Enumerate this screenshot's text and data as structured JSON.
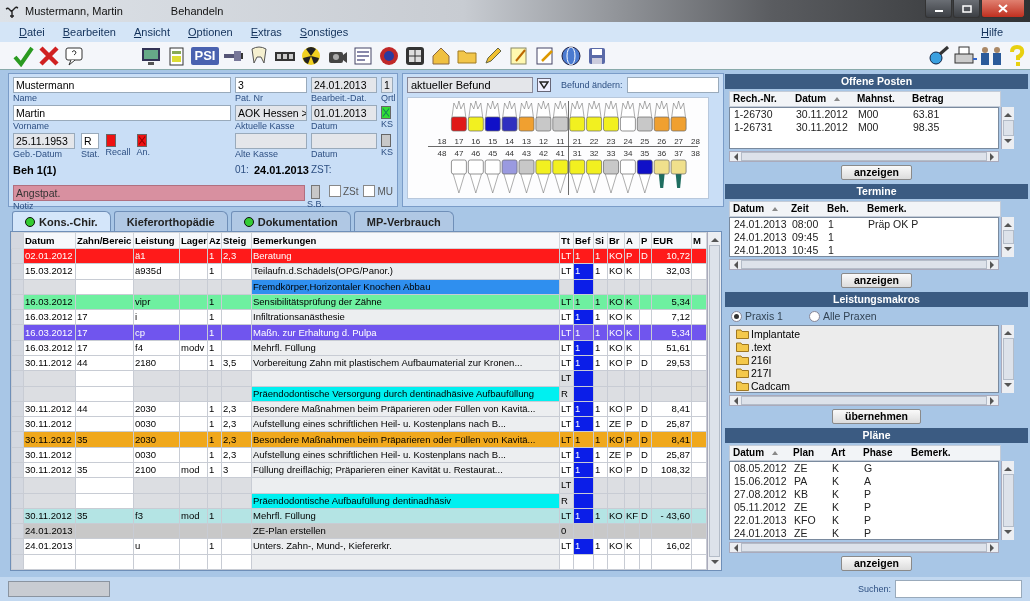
{
  "window": {
    "title": "Mustermann, Martin",
    "subtitle": "Behandeln"
  },
  "menu": [
    {
      "label": "Datei"
    },
    {
      "label": "Bearbeiten"
    },
    {
      "label": "Ansicht"
    },
    {
      "label": "Optionen"
    },
    {
      "label": "Extras"
    },
    {
      "label": "Sonstiges"
    }
  ],
  "help_menu": "Hilfe",
  "toolbar": {
    "psi_label": "PSI"
  },
  "patient": {
    "name": "Mustermann",
    "name_label": "Name",
    "first_name": "Martin",
    "first_name_label": "Vorname",
    "birth_date": "25.11.1953",
    "birth_date_label": "Geb.-Datum",
    "status": "R",
    "status_label": "Stat.",
    "flags": [
      {
        "label": "Recall",
        "color": "#ee1111",
        "crossed": false
      },
      {
        "label": "An.",
        "color": "#ee1111",
        "crossed": true
      }
    ],
    "treatment": "Beh 1(1)",
    "patient_no": "3",
    "patient_no_label": "Pat. Nr",
    "insurance": "AOK Hessen >",
    "insurance_label": "Aktuelle Kasse",
    "old_insurance_label": "Alte Kasse",
    "zst_prefix": "01:",
    "zst_date": "24.01.2013",
    "zst_label": "ZST:",
    "edit_date": "24.01.2013",
    "edit_date_label": "Bearbeit.-Dat.",
    "quarter": "1",
    "quarter_label": "Qrtl",
    "date": "01.01.2013",
    "date_label": "Datum",
    "old_date_label": "Datum",
    "ks": [
      {
        "label": "KS",
        "color": "#33dd33",
        "crossed": true
      },
      {
        "label": "KS",
        "color": "#c8c8c8",
        "crossed": false
      }
    ],
    "note": "Angstpat.",
    "note_label": "Notiz",
    "sb_label": "S.B.",
    "checks": [
      {
        "label": "ZSt",
        "checked": false
      },
      {
        "label": "MU",
        "checked": false
      }
    ]
  },
  "findings": {
    "view": "aktueller Befund",
    "change_label": "Befund ändern:",
    "upper": [
      {
        "number": "18",
        "kind": "gap"
      },
      {
        "number": "17",
        "kind": "tooth",
        "color": "#e01818"
      },
      {
        "number": "16",
        "kind": "tooth",
        "color": "#f2f020"
      },
      {
        "number": "15",
        "kind": "tooth",
        "color": "#1010c8"
      },
      {
        "number": "14",
        "kind": "tooth",
        "color": "#3030c0"
      },
      {
        "number": "13",
        "kind": "tooth",
        "color": "#f0a030"
      },
      {
        "number": "12",
        "kind": "tooth",
        "color": "#c8c8c8"
      },
      {
        "number": "11",
        "kind": "tooth",
        "color": "#c8c8c8"
      },
      {
        "number": "21",
        "kind": "tooth",
        "color": "#f2f020"
      },
      {
        "number": "22",
        "kind": "tooth",
        "color": "#f2f020"
      },
      {
        "number": "23",
        "kind": "tooth",
        "color": "#f2f020"
      },
      {
        "number": "24",
        "kind": "tooth",
        "color": "#ffffff"
      },
      {
        "number": "25",
        "kind": "tooth",
        "color": "#c8c8c8"
      },
      {
        "number": "26",
        "kind": "tooth",
        "color": "#f0a030"
      },
      {
        "number": "27",
        "kind": "tooth",
        "color": "#f0a030"
      },
      {
        "number": "28",
        "kind": "gap"
      }
    ],
    "lower": [
      {
        "number": "48",
        "kind": "gap"
      },
      {
        "number": "47",
        "kind": "tooth",
        "color": "#ffffff"
      },
      {
        "number": "46",
        "kind": "tooth",
        "color": "#ffffff"
      },
      {
        "number": "45",
        "kind": "tooth",
        "color": "#ffffff"
      },
      {
        "number": "44",
        "kind": "tooth",
        "color": "#9a9ae0"
      },
      {
        "number": "43",
        "kind": "tooth",
        "color": "#c8c8c8"
      },
      {
        "number": "42",
        "kind": "tooth",
        "color": "#f2f020"
      },
      {
        "number": "41",
        "kind": "tooth",
        "color": "#f2f020"
      },
      {
        "number": "31",
        "kind": "tooth",
        "color": "#f2f020"
      },
      {
        "number": "32",
        "kind": "tooth",
        "color": "#f2f020"
      },
      {
        "number": "33",
        "kind": "tooth",
        "color": "#c8c8c8"
      },
      {
        "number": "34",
        "kind": "tooth",
        "color": "#ffffff"
      },
      {
        "number": "35",
        "kind": "tooth",
        "color": "#1010c8"
      },
      {
        "number": "36",
        "kind": "implant",
        "color": "#f0e08c"
      },
      {
        "number": "37",
        "kind": "implant",
        "color": "#f0e08c"
      },
      {
        "number": "38",
        "kind": "gap"
      }
    ]
  },
  "tabs": [
    {
      "label": "Kons.-Chir.",
      "selected": true,
      "dot": true
    },
    {
      "label": "Kieferorthopädie",
      "selected": false,
      "dot": false
    },
    {
      "label": "Dokumentation",
      "selected": false,
      "dot": true
    },
    {
      "label": "MP-Verbrauch",
      "selected": false,
      "dot": false
    }
  ],
  "treatment_table": {
    "columns": [
      "Datum",
      "Zahn/Bereic",
      "Leistung",
      "Lager",
      "Az",
      "Steig",
      "Bemerkungen",
      "Tt",
      "Bef",
      "Si",
      "Br",
      "A",
      "P",
      "EUR",
      "M"
    ],
    "rows": [
      {
        "datum": "02.01.2012",
        "leistung": "ä1",
        "az": "1",
        "steig": "2,3",
        "bemerkung": "Beratung",
        "tt": "LT",
        "bef": "1",
        "si": "1",
        "br": "KO",
        "a": "P",
        "p": "D",
        "eur": "10,72",
        "color": "#ff1a1a",
        "bef_marked": false
      },
      {
        "datum": "15.03.2012",
        "leistung": "ä935d",
        "az": "1",
        "bemerkung": "Teilaufn.d.Schädels(OPG/Panor.)",
        "tt": "LT",
        "bef": "1",
        "si": "1",
        "br": "KO",
        "a": "K",
        "eur": "32,03",
        "bef_marked": true
      },
      {
        "bemerkung": "Fremdkörper,Horizontaler Knochen Abbau",
        "highlight": {
          "color": "#2f8fef"
        },
        "bef_marked": true
      },
      {
        "datum": "16.03.2012",
        "leistung": "vipr",
        "az": "1",
        "bemerkung": "Sensibilitätsprüfung der Zähne",
        "tt": "LT",
        "bef": "1",
        "si": "1",
        "br": "KO",
        "a": "K",
        "eur": "5,34",
        "color": "#6ef0a0",
        "bef_marked": false
      },
      {
        "datum": "16.03.2012",
        "zahn": "17",
        "leistung": "i",
        "az": "1",
        "bemerkung": "Infiltrationsanästhesie",
        "tt": "LT",
        "bef": "1",
        "si": "1",
        "br": "KO",
        "a": "K",
        "eur": "7,12",
        "bef_marked": true
      },
      {
        "datum": "16.03.2012",
        "zahn": "17",
        "leistung": "cp",
        "az": "1",
        "bemerkung": "Maßn. zur Erhaltung d. Pulpa",
        "tt": "LT",
        "bef": "1",
        "si": "1",
        "br": "KO",
        "a": "K",
        "eur": "5,34",
        "color": "#7055ee",
        "bef_marked": false
      },
      {
        "datum": "16.03.2012",
        "zahn": "17",
        "leistung": "f4",
        "lager": "modv",
        "az": "1",
        "bemerkung": "Mehrfl. Füllung",
        "tt": "LT",
        "bef": "1",
        "si": "1",
        "br": "KO",
        "a": "K",
        "eur": "51,61",
        "bef_marked": true
      },
      {
        "datum": "30.11.2012",
        "zahn": "44",
        "leistung": "2180",
        "az": "1",
        "steig": "3,5",
        "bemerkung": "Vorbereitung Zahn mit plastischem Aufbaumaterial zur Kronen...",
        "tt": "LT",
        "bef": "1",
        "si": "1",
        "br": "KO",
        "a": "P",
        "p": "D",
        "eur": "29,53",
        "bef_marked": true
      },
      {
        "tt": "LT",
        "bef_marked": true
      },
      {
        "bemerkung": "Präendodontische Versorgung durch dentinadhäsive Aufbaufüllung",
        "highlight": {
          "color": "#00f0f0"
        },
        "tt": "R",
        "bef_marked": true
      },
      {
        "datum": "30.11.2012",
        "zahn": "44",
        "leistung": "2030",
        "az": "1",
        "steig": "2,3",
        "bemerkung": "Besondere Maßnahmen beim Präparieren oder Füllen von Kavitä...",
        "tt": "LT",
        "bef": "1",
        "si": "1",
        "br": "KO",
        "a": "P",
        "p": "D",
        "eur": "8,41",
        "bef_marked": true
      },
      {
        "datum": "30.11.2012",
        "leistung": "0030",
        "az": "1",
        "steig": "2,3",
        "bemerkung": "Aufstellung eines schriftlichen Heil- u. Kostenplans nach B...",
        "tt": "LT",
        "bef": "1",
        "si": "1",
        "br": "ZE",
        "a": "P",
        "p": "D",
        "eur": "25,87",
        "bef_marked": true
      },
      {
        "datum": "30.11.2012",
        "zahn": "35",
        "leistung": "2030",
        "az": "1",
        "steig": "2,3",
        "bemerkung": "Besondere Maßnahmen beim Präparieren oder Füllen von Kavitä...",
        "tt": "LT",
        "bef": "1",
        "si": "1",
        "br": "KO",
        "a": "P",
        "p": "D",
        "eur": "8,41",
        "color": "#f0a81c",
        "bef_marked": false
      },
      {
        "datum": "30.11.2012",
        "leistung": "0030",
        "az": "1",
        "steig": "2,3",
        "bemerkung": "Aufstellung eines schriftlichen Heil- u. Kostenplans nach B...",
        "tt": "LT",
        "bef": "1",
        "si": "1",
        "br": "ZE",
        "a": "P",
        "p": "D",
        "eur": "25,87",
        "bef_marked": true
      },
      {
        "datum": "30.11.2012",
        "zahn": "35",
        "leistung": "2100",
        "lager": "mod",
        "az": "1",
        "steig": "3",
        "bemerkung": "Füllung dreiflächig; Präparieren einer Kavität u. Restaurat...",
        "tt": "LT",
        "bef": "1",
        "si": "1",
        "br": "KO",
        "a": "P",
        "p": "D",
        "eur": "108,32",
        "bef_marked": true
      },
      {
        "tt": "LT",
        "bef_marked": true
      },
      {
        "bemerkung": "Präendodontische Aufbaufüllung dentinadhäsiv",
        "highlight": {
          "color": "#00f0f0"
        },
        "tt": "R",
        "bef_marked": true
      },
      {
        "datum": "30.11.2012",
        "zahn": "35",
        "leistung": "f3",
        "lager": "mod",
        "az": "1",
        "bemerkung": "Mehrfl. Füllung",
        "tt": "LT",
        "bef": "1",
        "si": "1",
        "br": "KO",
        "a": "KF",
        "p": "D",
        "eur": "- 43,60",
        "color": "#b4e4e4",
        "bef_marked": true
      },
      {
        "datum": "24.01.2013",
        "bemerkung": "ZE-Plan erstellen",
        "tt": "0",
        "color": "#c8c8c8",
        "bef_marked": false
      },
      {
        "datum": "24.01.2013",
        "leistung": "u",
        "az": "1",
        "bemerkung": "Unters. Zahn-, Mund-, Kiefererkr.",
        "tt": "LT",
        "bef": "1",
        "si": "1",
        "br": "KO",
        "a": "K",
        "eur": "16,02",
        "bef_marked": true
      }
    ]
  },
  "open_items": {
    "title": "Offene Posten",
    "columns": [
      {
        "label": "Rech.-Nr.",
        "sorted": false
      },
      {
        "label": "Datum",
        "sorted": true
      },
      {
        "label": "Mahnst.",
        "sorted": false
      },
      {
        "label": "Betrag",
        "sorted": false
      }
    ],
    "rows": [
      [
        "1-26730",
        "30.11.2012",
        "M00",
        "63.81"
      ],
      [
        "1-26731",
        "30.11.2012",
        "M00",
        "98.35"
      ]
    ],
    "button": "anzeigen"
  },
  "appointments": {
    "title": "Termine",
    "columns": [
      {
        "label": "Datum",
        "sorted": true
      },
      {
        "label": "Zeit",
        "sorted": false
      },
      {
        "label": "Beh.",
        "sorted": false
      },
      {
        "label": "Bemerk.",
        "sorted": false
      }
    ],
    "rows": [
      [
        "24.01.2013",
        "08:00",
        "1",
        "Präp OK P"
      ],
      [
        "24.01.2013",
        "09:45",
        "1"
      ],
      [
        "24.01.2013",
        "10:45",
        "1"
      ]
    ],
    "button": "anzeigen"
  },
  "macros": {
    "title": "Leistungsmakros",
    "scopes": [
      {
        "label": "Praxis 1",
        "selected": true
      },
      {
        "label": "Alle Praxen",
        "selected": false
      }
    ],
    "folders": [
      "Implantate",
      ".text",
      "216I",
      "217I",
      "Cadcam"
    ],
    "button": "übernehmen"
  },
  "plans": {
    "title": "Pläne",
    "columns": [
      {
        "label": "Datum",
        "sorted": true
      },
      {
        "label": "Plan",
        "sorted": false
      },
      {
        "label": "Art",
        "sorted": false
      },
      {
        "label": "Phase",
        "sorted": false
      },
      {
        "label": "Bemerk.",
        "sorted": false
      }
    ],
    "rows": [
      [
        "08.05.2012",
        "ZE",
        "K",
        "G"
      ],
      [
        "15.06.2012",
        "PA",
        "K",
        "A"
      ],
      [
        "27.08.2012",
        "KB",
        "K",
        "P"
      ],
      [
        "05.11.2012",
        "ZE",
        "K",
        "P"
      ],
      [
        "22.01.2013",
        "KFO",
        "K",
        "P"
      ],
      [
        "24.01.2013",
        "ZE",
        "K",
        "P"
      ]
    ],
    "button": "anzeigen"
  },
  "status_bar": {
    "search_label": "Suchen:"
  }
}
